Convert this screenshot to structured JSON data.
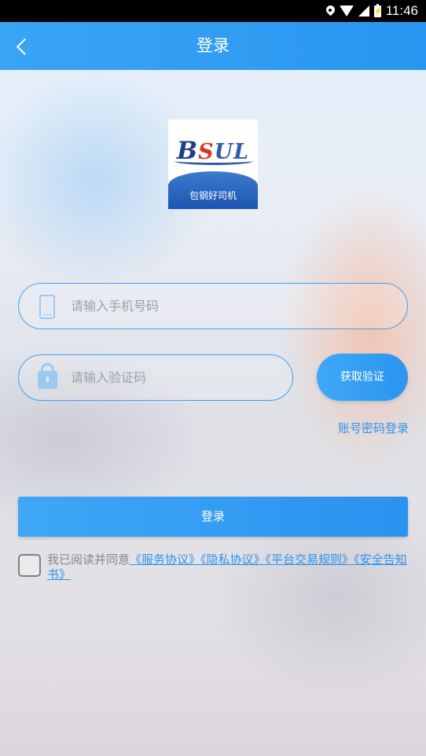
{
  "status_bar": {
    "time": "11:46"
  },
  "header": {
    "title": "登录"
  },
  "logo": {
    "mark_b": "B",
    "mark_s": "S",
    "mark_rest": "UL",
    "caption": "包钢好司机"
  },
  "form": {
    "phone_placeholder": "请输入手机号码",
    "code_placeholder": "请输入验证码",
    "get_code_label": "获取验证",
    "password_login_link": "账号密码登录",
    "login_button": "登录"
  },
  "agreement": {
    "prefix": "我已阅读并同意",
    "links": [
      "《服务协议》",
      "《隐私协议》",
      "《平台交易规则》",
      "《安全告知书》"
    ]
  },
  "colors": {
    "primary": "#2b95f0",
    "link": "#2c93ec",
    "icon": "#9cc9f2"
  }
}
